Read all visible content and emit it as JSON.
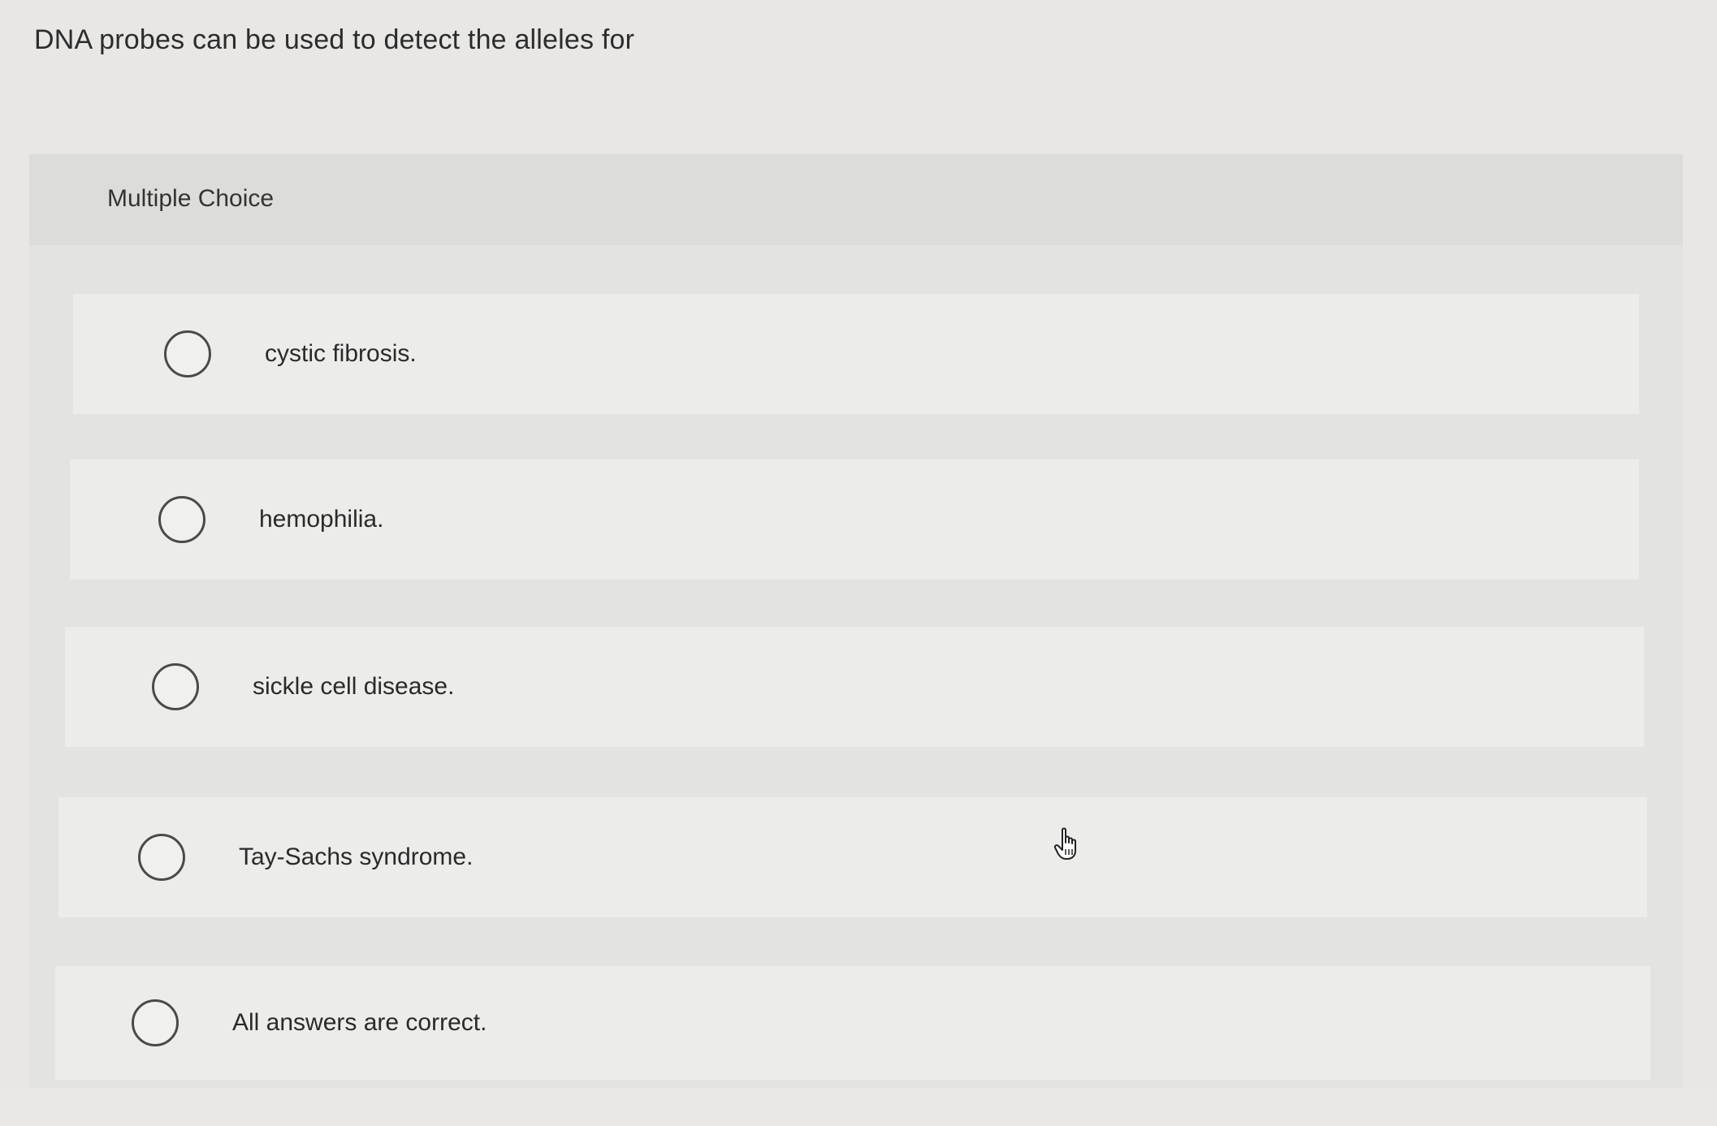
{
  "question": {
    "text": "DNA probes can be used to detect the alleles for"
  },
  "panel": {
    "header_label": "Multiple Choice"
  },
  "options": [
    {
      "label": "cystic fibrosis."
    },
    {
      "label": "hemophilia."
    },
    {
      "label": "sickle cell disease."
    },
    {
      "label": "Tay-Sachs syndrome."
    },
    {
      "label": "All answers are correct."
    }
  ],
  "colors": {
    "background": "#e8e7e5",
    "panel_header": "#dcdcda",
    "option_background": "#ececea",
    "radio_border": "#4a4a4a"
  },
  "icons": {
    "cursor": "hand-pointer-icon"
  }
}
